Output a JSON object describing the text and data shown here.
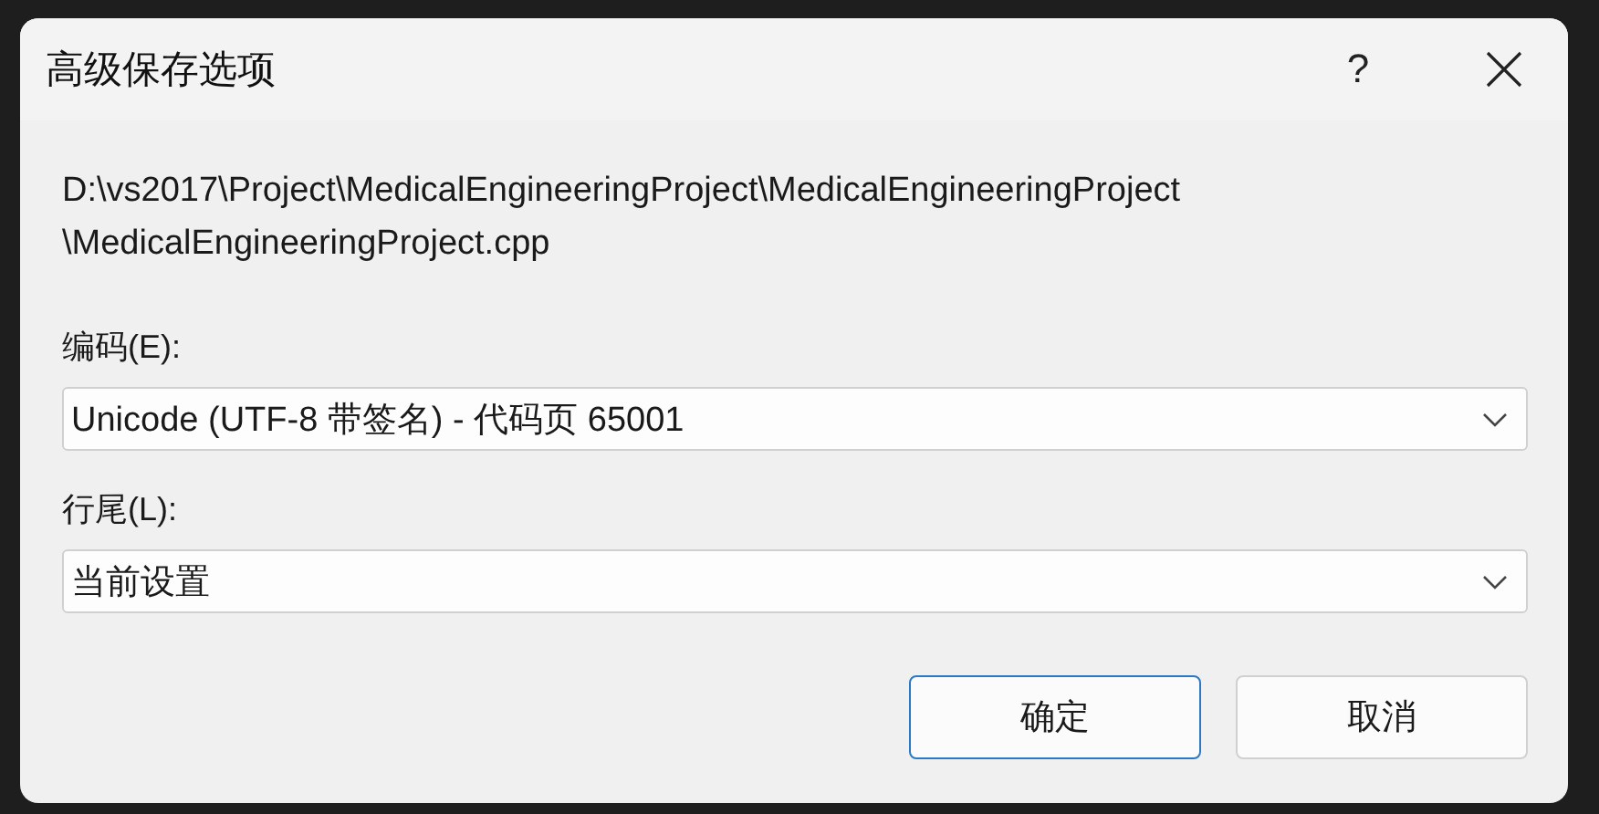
{
  "window": {
    "title": "高级保存选项",
    "help": "?"
  },
  "path_lines": [
    "D:\\vs2017\\Project\\MedicalEngineeringProject\\MedicalEngineeringProject",
    "\\MedicalEngineeringProject.cpp"
  ],
  "fields": [
    {
      "label": "编码(E):",
      "value": "Unicode (UTF-8 带签名) - 代码页 65001"
    },
    {
      "label": "行尾(L):",
      "value": "当前设置"
    }
  ],
  "buttons": [
    {
      "label": "确定",
      "default": true
    },
    {
      "label": "取消",
      "default": false
    }
  ]
}
